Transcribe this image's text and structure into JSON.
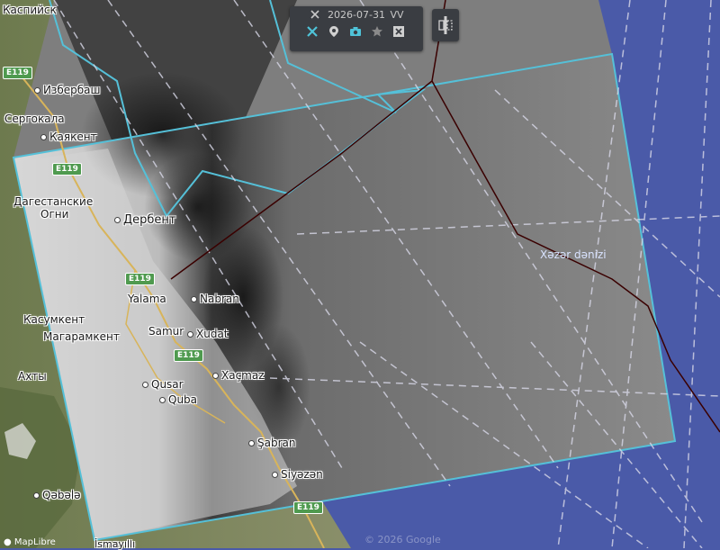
{
  "toolbar": {
    "date": "2026-07-31",
    "polarization": "VV",
    "tools": [
      {
        "icon": "tools-crossed-icon"
      },
      {
        "icon": "pin-icon"
      },
      {
        "icon": "camera-icon"
      },
      {
        "icon": "star-icon"
      },
      {
        "icon": "close-box-icon"
      }
    ]
  },
  "map": {
    "sea_label": "Xəzər dənizi",
    "places": [
      "Каспийск",
      "Избербаш",
      "Сергокала",
      "Каякент",
      "Дагестанские",
      "Огни",
      "Дербент",
      "Yalama",
      "Nabran",
      "Касумкент",
      "Магарамкент",
      "Samur",
      "Xudat",
      "Ахты",
      "Qusar",
      "Xaçmaz",
      "Quba",
      "Şabran",
      "Siyəzən",
      "Qəbələ",
      "İsmayıllı"
    ],
    "road_shields": [
      "E119",
      "E119",
      "E119",
      "E119",
      "E119"
    ],
    "watermark": "© 2026 Google",
    "attribution": "MapLibre",
    "colors": {
      "overlay_outline": "#55c0d8",
      "sea": "#4a5aa8",
      "route_dash": "#d8d8e8",
      "border_line": "#3a0000"
    }
  }
}
